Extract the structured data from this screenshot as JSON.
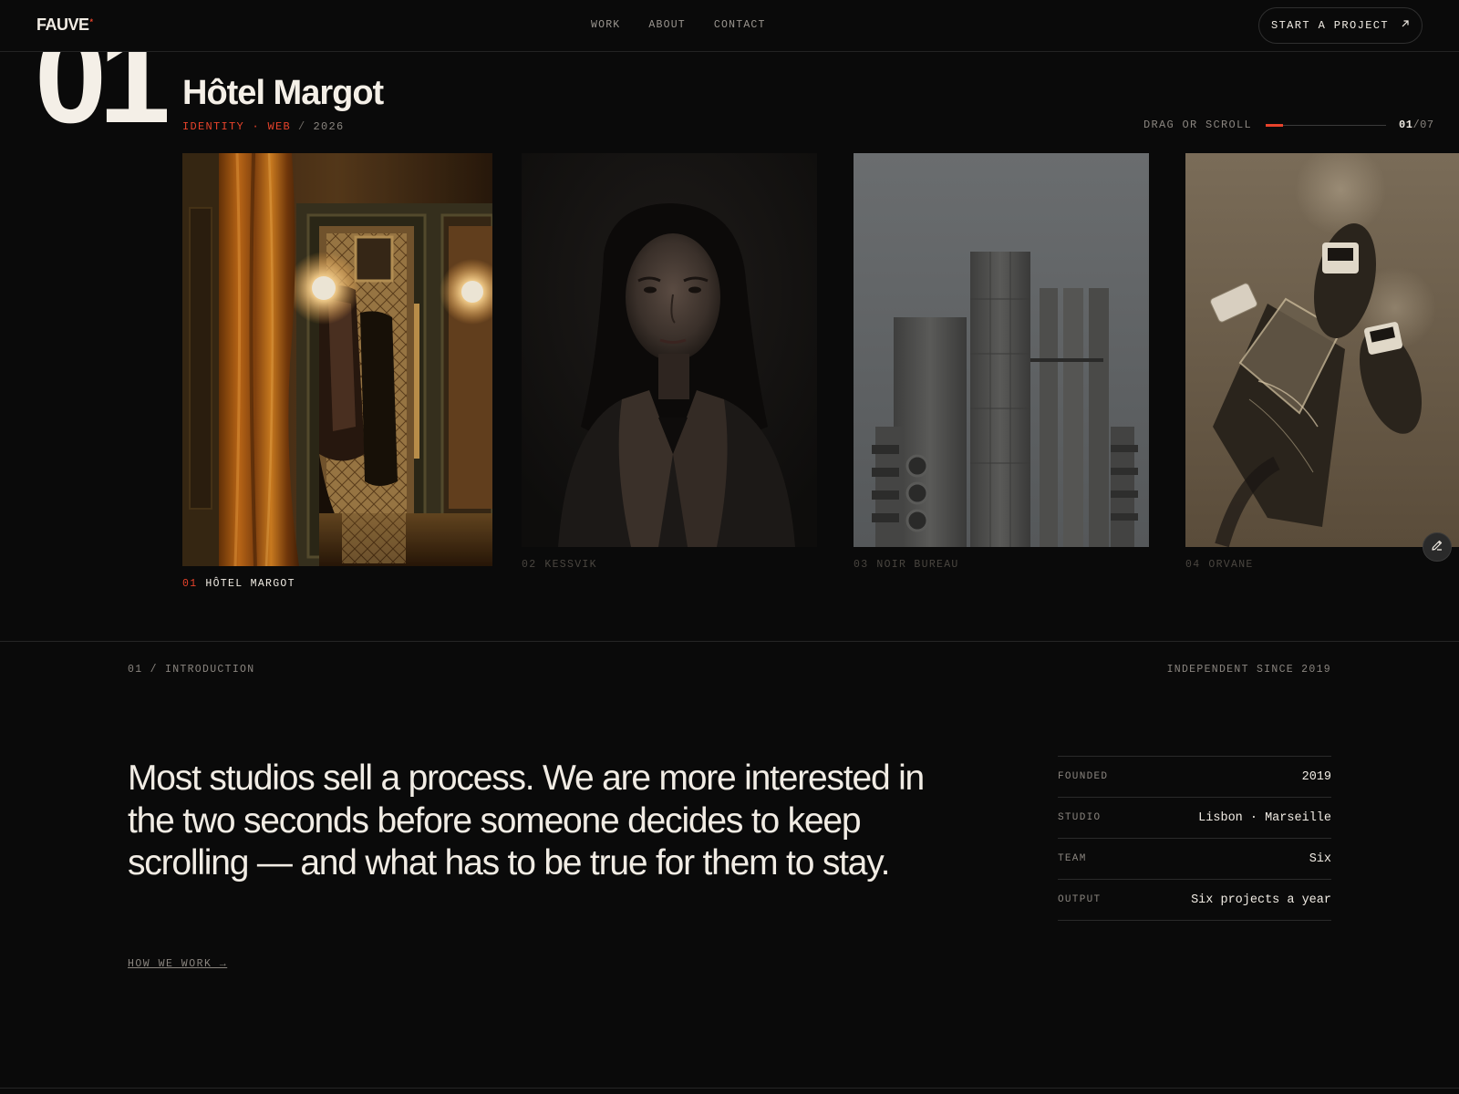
{
  "brand": {
    "logo": "FAUVE",
    "logo_mark": "*"
  },
  "nav": [
    "WORK",
    "ABOUT",
    "CONTACT"
  ],
  "cta": {
    "label": "START A PROJECT",
    "icon": "arrow-up-right-icon"
  },
  "project": {
    "number": "01",
    "title": "Hôtel Margot",
    "tags": "IDENTITY · WEB",
    "separator": "/",
    "year": "2026"
  },
  "slider": {
    "hint": "DRAG OR SCROLL",
    "current": "01",
    "total": "/07",
    "progress": 0.14
  },
  "cards": [
    {
      "num": "01",
      "name": "HÔTEL MARGOT",
      "active": true
    },
    {
      "num": "02",
      "name": "KESSVIK",
      "active": false
    },
    {
      "num": "03",
      "name": "NOIR BUREAU",
      "active": false
    },
    {
      "num": "04",
      "name": "ORVANE",
      "active": false
    }
  ],
  "intro": {
    "section_label": "01 / INTRODUCTION",
    "since": "INDEPENDENT SINCE 2019",
    "statement": "Most studios sell a process. We are more interested in the two seconds before someone decides to keep scrolling — and what has to be true for them to stay.",
    "link": "HOW WE WORK →",
    "facts": [
      {
        "key": "FOUNDED",
        "value": "2019"
      },
      {
        "key": "STUDIO",
        "value": "Lisbon · Marseille"
      },
      {
        "key": "TEAM",
        "value": "Six"
      },
      {
        "key": "OUTPUT",
        "value": "Six projects a year"
      }
    ]
  },
  "colors": {
    "accent": "#e8432b",
    "background": "#0a0a0a",
    "text": "#f1ece4",
    "muted": "#8a857f"
  }
}
